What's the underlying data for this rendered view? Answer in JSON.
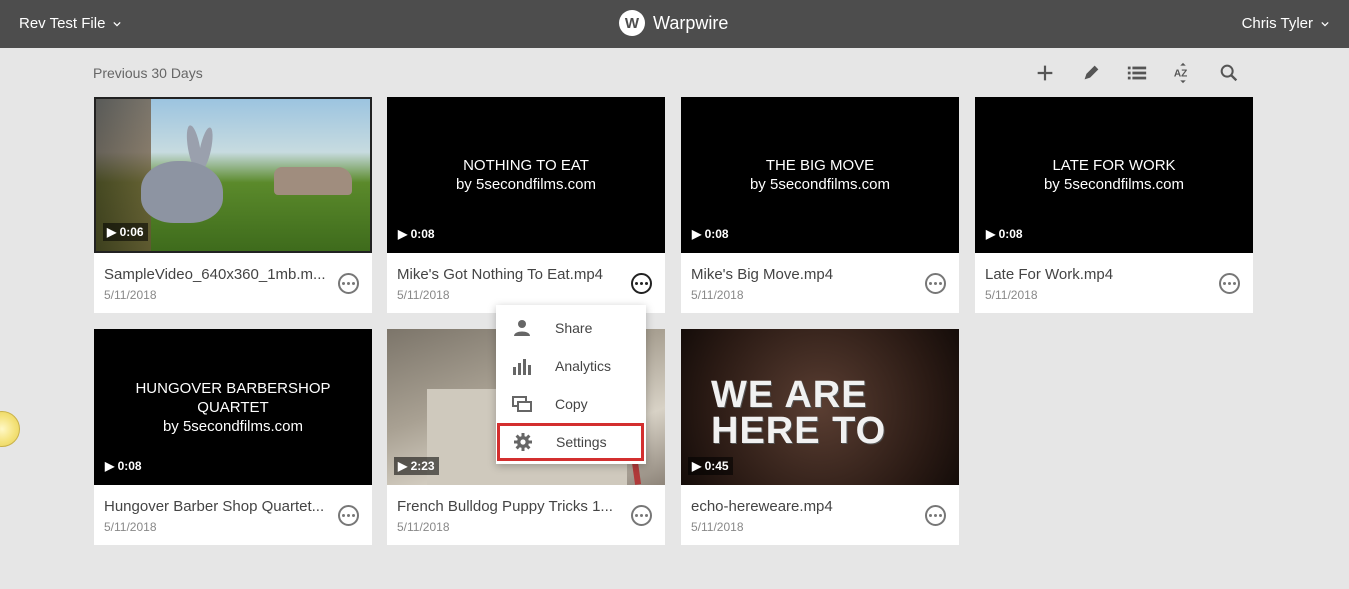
{
  "topbar": {
    "folder_name": "Rev Test File",
    "brand_name": "Warpwire",
    "brand_logo_letter": "W",
    "user_name": "Chris Tyler"
  },
  "section_label": "Previous 30 Days",
  "toolbar": {
    "icons": [
      "plus-icon",
      "pencil-icon",
      "list-view-icon",
      "sort-az-icon",
      "search-icon"
    ]
  },
  "videos": [
    {
      "title": "SampleVideo_640x360_1mb.mp4",
      "display_title": "SampleVideo_640x360_1mb.m...",
      "date": "5/11/2018",
      "duration": "▶ 0:06",
      "thumb_text": ""
    },
    {
      "title": "Mike's Got Nothing To Eat.mp4",
      "display_title": "Mike's Got Nothing To Eat.mp4",
      "date": "5/11/2018",
      "duration": "▶ 0:08",
      "thumb_text": "NOTHING TO EAT\nby 5secondfilms.com"
    },
    {
      "title": "Mike's Big Move.mp4",
      "display_title": "Mike's Big Move.mp4",
      "date": "5/11/2018",
      "duration": "▶ 0:08",
      "thumb_text": "THE BIG MOVE\nby 5secondfilms.com"
    },
    {
      "title": "Late For Work.mp4",
      "display_title": "Late For Work.mp4",
      "date": "5/11/2018",
      "duration": "▶ 0:08",
      "thumb_text": "LATE FOR WORK\nby 5secondfilms.com"
    },
    {
      "title": "Hungover Barber Shop Quartet",
      "display_title": "Hungover Barber Shop Quartet...",
      "date": "5/11/2018",
      "duration": "▶ 0:08",
      "thumb_text": "HUNGOVER BARBERSHOP\nQUARTET\nby 5secondfilms.com"
    },
    {
      "title": "French Bulldog Puppy Tricks 1",
      "display_title": "French Bulldog Puppy Tricks 1...",
      "date": "5/11/2018",
      "duration": "▶ 2:23",
      "thumb_text": ""
    },
    {
      "title": "echo-hereweare.mp4",
      "display_title": "echo-hereweare.mp4",
      "date": "5/11/2018",
      "duration": "▶ 0:45",
      "thumb_text": "WE ARE\nHERE TO"
    }
  ],
  "context_menu": {
    "items": [
      {
        "label": "Share",
        "icon": "person-icon"
      },
      {
        "label": "Analytics",
        "icon": "bar-chart-icon"
      },
      {
        "label": "Copy",
        "icon": "copy-icon"
      },
      {
        "label": "Settings",
        "icon": "gear-icon",
        "highlighted": true
      }
    ]
  },
  "colors": {
    "topbar_bg": "#4d4d4d",
    "page_bg": "#e6e6e6",
    "highlight_border": "#d32f2f"
  }
}
